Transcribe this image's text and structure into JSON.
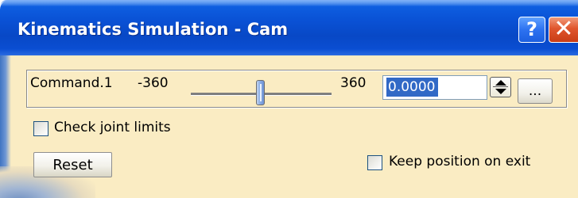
{
  "window": {
    "title": "Kinematics Simulation - Cam",
    "help_label": "?",
    "close_label": "✕"
  },
  "command": {
    "name": "Command.1",
    "min": "-360",
    "max": "360",
    "slider_fraction": 0.5,
    "value": "0.0000",
    "more_label": "..."
  },
  "options": {
    "check_joint_limits": {
      "label": "Check joint limits",
      "checked": false
    },
    "keep_position": {
      "label": "Keep position on exit",
      "checked": false
    }
  },
  "buttons": {
    "reset": "Reset"
  },
  "icons": {
    "help": "help-icon",
    "close": "close-icon",
    "spinner": "spin-updown-icon"
  },
  "colors": {
    "titlebar": "#0a52d6",
    "client_background": "#faecc3",
    "selection": "#3169c6",
    "close_button": "#e0562e"
  }
}
